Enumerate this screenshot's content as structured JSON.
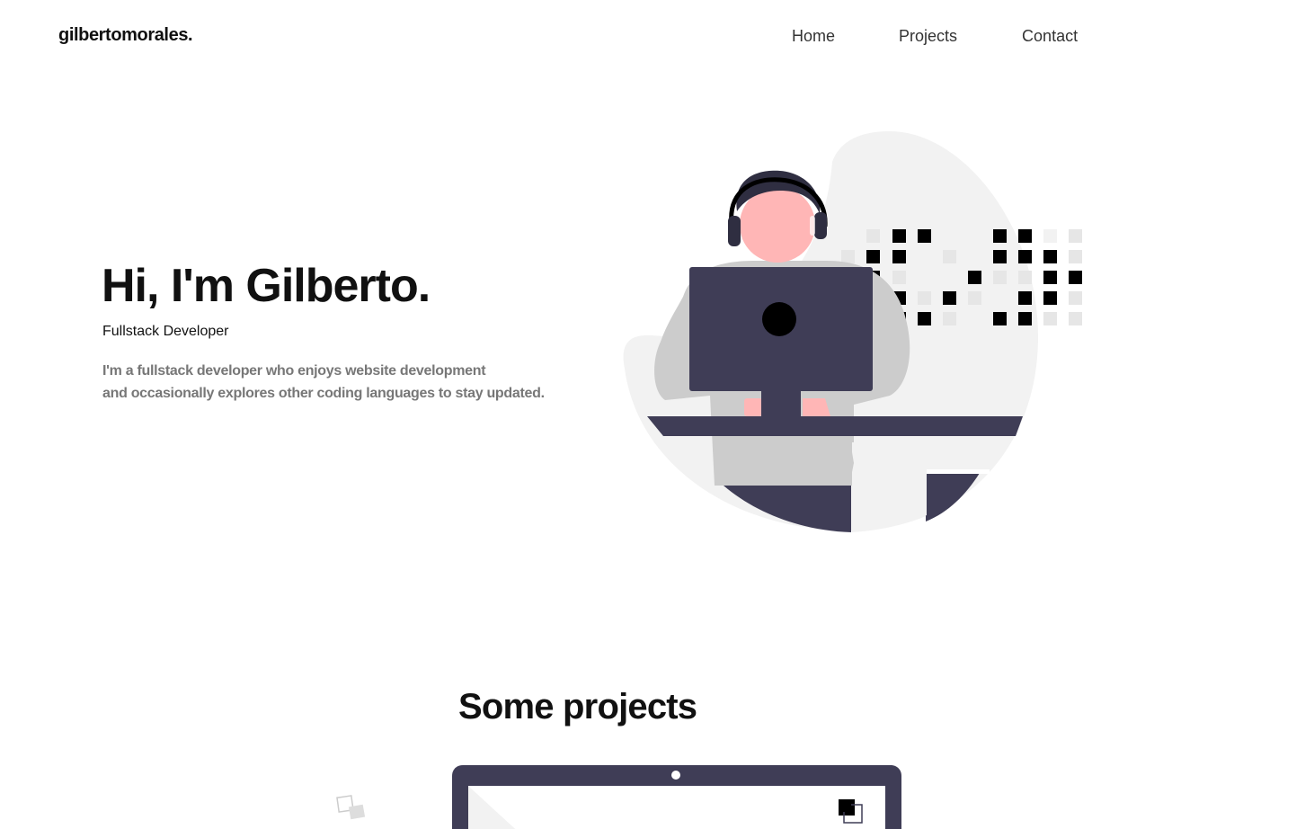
{
  "header": {
    "brand": "gilbertomorales.",
    "nav": [
      {
        "label": "Home"
      },
      {
        "label": "Projects"
      },
      {
        "label": "Contact"
      }
    ]
  },
  "hero": {
    "title": "Hi, I'm Gilberto.",
    "role": "Fullstack Developer",
    "description_line1": "I'm a fullstack developer who enjoys website development",
    "description_line2": "and occasionally explores other coding languages to stay updated."
  },
  "projects": {
    "title": "Some projects"
  },
  "colors": {
    "text": "#111111",
    "muted": "#777777",
    "dark": "#3f3d56",
    "skin": "#ffb6b6",
    "light_gray": "#f2f2f2",
    "mid_gray": "#cccccc"
  },
  "icons": [
    "developer-illustration",
    "laptop-illustration",
    "squares-decoration"
  ]
}
